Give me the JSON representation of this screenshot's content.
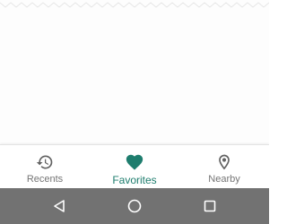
{
  "bottom_nav": {
    "items": [
      {
        "label": "Recents",
        "icon": "history-icon",
        "active": false
      },
      {
        "label": "Favorites",
        "icon": "heart-icon",
        "active": true
      },
      {
        "label": "Nearby",
        "icon": "location-pin-icon",
        "active": false
      }
    ]
  },
  "system_nav": {
    "buttons": [
      "back-icon",
      "home-icon",
      "recents-apps-icon"
    ]
  },
  "colors": {
    "accent": "#1e7d6e",
    "inactive": "#757575",
    "system_bar": "#727272"
  }
}
